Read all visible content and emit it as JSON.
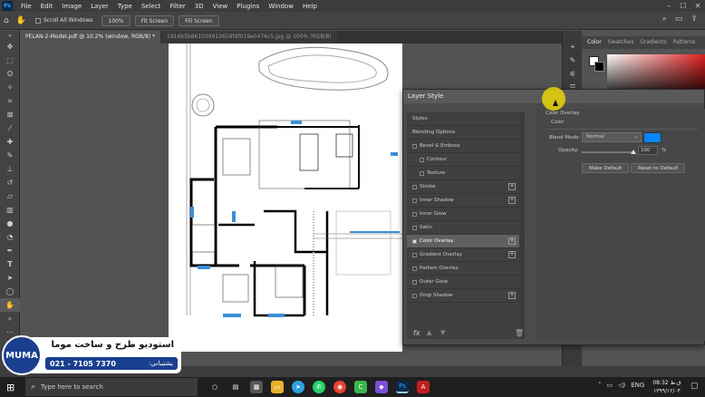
{
  "menubar": {
    "app_logo": "Ps",
    "items": [
      "File",
      "Edit",
      "Image",
      "Layer",
      "Type",
      "Select",
      "Filter",
      "3D",
      "View",
      "Plugins",
      "Window",
      "Help"
    ]
  },
  "options": {
    "scroll_all_windows": "Scroll All Windows",
    "zoom": "100%",
    "fit_screen": "Fit Screen",
    "fill_screen": "Fill Screen"
  },
  "tabs": [
    {
      "label": "PELAN-2-Model.pdf @ 10.2% (window, RGB/8) *"
    },
    {
      "label": "1916b5b861039912658fdf019e0476c5.jpg @ 100% (RGB/8)"
    }
  ],
  "panel": {
    "tabs": [
      "Color",
      "Swatches",
      "Gradients",
      "Patterns"
    ],
    "active_tab": "Color"
  },
  "layer_style": {
    "title": "Layer Style",
    "items": [
      {
        "label": "Styles",
        "checkbox": false,
        "plus": false,
        "checked": false,
        "indent": false,
        "selected": false
      },
      {
        "label": "Blending Options",
        "checkbox": false,
        "plus": false,
        "checked": false,
        "indent": false,
        "selected": false
      },
      {
        "label": "Bevel & Emboss",
        "checkbox": true,
        "plus": false,
        "checked": false,
        "indent": false,
        "selected": false
      },
      {
        "label": "Contour",
        "checkbox": true,
        "plus": false,
        "checked": false,
        "indent": true,
        "selected": false
      },
      {
        "label": "Texture",
        "checkbox": true,
        "plus": false,
        "checked": false,
        "indent": true,
        "selected": false
      },
      {
        "label": "Stroke",
        "checkbox": true,
        "plus": true,
        "checked": false,
        "indent": false,
        "selected": false
      },
      {
        "label": "Inner Shadow",
        "checkbox": true,
        "plus": true,
        "checked": false,
        "indent": false,
        "selected": false
      },
      {
        "label": "Inner Glow",
        "checkbox": true,
        "plus": false,
        "checked": false,
        "indent": false,
        "selected": false
      },
      {
        "label": "Satin",
        "checkbox": true,
        "plus": false,
        "checked": false,
        "indent": false,
        "selected": false
      },
      {
        "label": "Color Overlay",
        "checkbox": true,
        "plus": true,
        "checked": true,
        "indent": false,
        "selected": true
      },
      {
        "label": "Gradient Overlay",
        "checkbox": true,
        "plus": true,
        "checked": false,
        "indent": false,
        "selected": false
      },
      {
        "label": "Pattern Overlay",
        "checkbox": true,
        "plus": false,
        "checked": false,
        "indent": false,
        "selected": false
      },
      {
        "label": "Outer Glow",
        "checkbox": true,
        "plus": false,
        "checked": false,
        "indent": false,
        "selected": false
      },
      {
        "label": "Drop Shadow",
        "checkbox": true,
        "plus": true,
        "checked": false,
        "indent": false,
        "selected": false
      }
    ],
    "section_title": "Color Overlay",
    "group_title": "Color",
    "blend_mode_label": "Blend Mode:",
    "blend_mode_value": "Normal",
    "overlay_color": "#0a84ff",
    "opacity_label": "Opacity:",
    "opacity_value": "100",
    "opacity_unit": "%",
    "make_default": "Make Default",
    "reset_default": "Reset to Default",
    "fx": "fx"
  },
  "branding": {
    "logo_text": "MUMA",
    "studio_name": "استودیو طرح و ساخت موما",
    "support_label": "پشتیبانی:",
    "phone": "021 - 7105 7370"
  },
  "taskbar": {
    "search_placeholder": "Type here to search",
    "lang": "ENG",
    "time": "08:32 ق.ظ",
    "date": "۱۳۹۹/۱۲/۰۴"
  }
}
